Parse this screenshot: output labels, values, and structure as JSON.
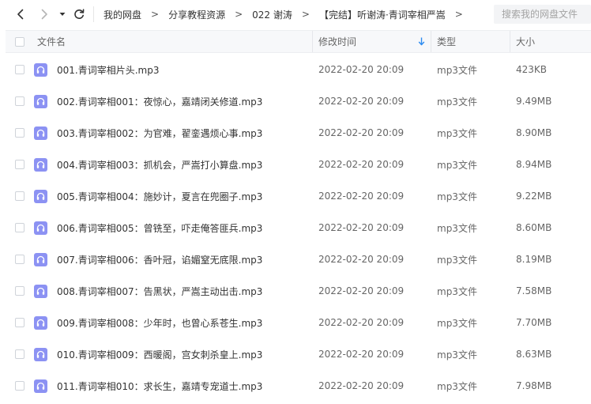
{
  "breadcrumb": [
    "我的网盘",
    "分享教程资源",
    "022 谢涛",
    "【完结】听谢涛·青词宰相严嵩"
  ],
  "search": {
    "placeholder": "搜索我的网盘文件"
  },
  "columns": {
    "name": "文件名",
    "modified": "修改时间",
    "type": "类型",
    "size": "大小"
  },
  "sort": {
    "column": "modified",
    "direction": "desc"
  },
  "colors": {
    "accent": "#2e8cf0",
    "file_icon": "#8c92f3",
    "header_bg": "#f7f8fa"
  },
  "icons": [
    "back-icon",
    "forward-icon",
    "history-dropdown-icon",
    "refresh-icon",
    "sort-down-icon",
    "audio-file-icon"
  ],
  "files": [
    {
      "name": "001.青词宰相片头.mp3",
      "modified": "2022-02-20 20:09",
      "type": "mp3文件",
      "size": "423KB"
    },
    {
      "name": "002.青词宰相001：夜惊心，嘉靖闭关修道.mp3",
      "modified": "2022-02-20 20:09",
      "type": "mp3文件",
      "size": "9.49MB"
    },
    {
      "name": "003.青词宰相002：为官难，翟銮遇烦心事.mp3",
      "modified": "2022-02-20 20:09",
      "type": "mp3文件",
      "size": "8.90MB"
    },
    {
      "name": "004.青词宰相003：抓机会，严嵩打小算盘.mp3",
      "modified": "2022-02-20 20:09",
      "type": "mp3文件",
      "size": "8.94MB"
    },
    {
      "name": "005.青词宰相004：施妙计，夏言在兜圈子.mp3",
      "modified": "2022-02-20 20:09",
      "type": "mp3文件",
      "size": "9.22MB"
    },
    {
      "name": "006.青词宰相005：曾铣至，吓走俺答匪兵.mp3",
      "modified": "2022-02-20 20:09",
      "type": "mp3文件",
      "size": "8.60MB"
    },
    {
      "name": "007.青词宰相006：香叶冠，谄媚窒无底限.mp3",
      "modified": "2022-02-20 20:09",
      "type": "mp3文件",
      "size": "8.19MB"
    },
    {
      "name": "008.青词宰相007：告黑状，严嵩主动出击.mp3",
      "modified": "2022-02-20 20:09",
      "type": "mp3文件",
      "size": "7.58MB"
    },
    {
      "name": "009.青词宰相008：少年时，也曾心系苍生.mp3",
      "modified": "2022-02-20 20:09",
      "type": "mp3文件",
      "size": "7.70MB"
    },
    {
      "name": "010.青词宰相009：西暖阁，宫女刺杀皇上.mp3",
      "modified": "2022-02-20 20:09",
      "type": "mp3文件",
      "size": "8.63MB"
    },
    {
      "name": "011.青词宰相010：求长生，嘉靖专宠道士.mp3",
      "modified": "2022-02-20 20:09",
      "type": "mp3文件",
      "size": "7.98MB"
    }
  ]
}
